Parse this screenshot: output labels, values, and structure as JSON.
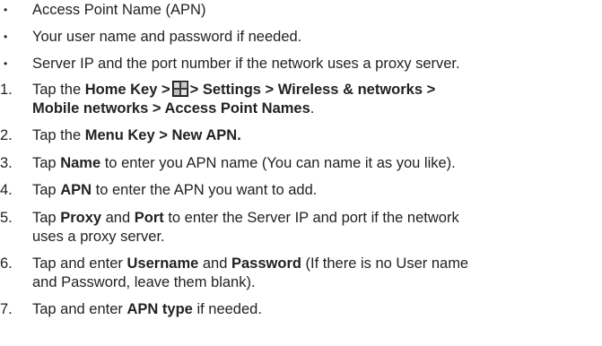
{
  "bullets": [
    "Access Point Name (APN)",
    "Your user name and password if needed.",
    "Server IP and the port number if the network uses a proxy server."
  ],
  "steps": [
    {
      "num": "1.",
      "line1": [
        {
          "t": "Tap the ",
          "b": false
        },
        {
          "t": "Home Key >",
          "b": true
        },
        {
          "icon": "settings-launcher-icon"
        },
        {
          "t": "> Settings > Wireless & networks >",
          "b": true
        }
      ],
      "line2": [
        {
          "t": "Mobile networks > Access Point Names",
          "b": true
        },
        {
          "t": ".",
          "b": false
        }
      ]
    },
    {
      "num": "2.",
      "line1": [
        {
          "t": "Tap the ",
          "b": false
        },
        {
          "t": "Menu Key > New APN.",
          "b": true
        }
      ]
    },
    {
      "num": "3.",
      "line1": [
        {
          "t": "Tap ",
          "b": false
        },
        {
          "t": "Name",
          "b": true
        },
        {
          "t": " to enter you APN name (You can name it as you like).",
          "b": false
        }
      ]
    },
    {
      "num": "4.",
      "line1": [
        {
          "t": "Tap ",
          "b": false
        },
        {
          "t": "APN",
          "b": true
        },
        {
          "t": " to enter the APN you want to add.",
          "b": false
        }
      ]
    },
    {
      "num": "5.",
      "line1": [
        {
          "t": "Tap ",
          "b": false
        },
        {
          "t": "Proxy",
          "b": true
        },
        {
          "t": " and ",
          "b": false
        },
        {
          "t": "Port",
          "b": true
        },
        {
          "t": " to enter the Server IP and port if the network",
          "b": false
        }
      ],
      "line2": [
        {
          "t": "uses a proxy server.",
          "b": false
        }
      ]
    },
    {
      "num": "6.",
      "line1": [
        {
          "t": "Tap and enter ",
          "b": false
        },
        {
          "t": "Username",
          "b": true
        },
        {
          "t": " and ",
          "b": false
        },
        {
          "t": "Password",
          "b": true
        },
        {
          "t": " (If there is no User name",
          "b": false
        }
      ],
      "line2": [
        {
          "t": "and Password, leave them blank).",
          "b": false
        }
      ]
    },
    {
      "num": "7.",
      "line1": [
        {
          "t": "Tap and enter ",
          "b": false
        },
        {
          "t": "APN type",
          "b": true
        },
        {
          "t": " if needed.",
          "b": false
        }
      ]
    }
  ],
  "bullet_glyph": "•"
}
